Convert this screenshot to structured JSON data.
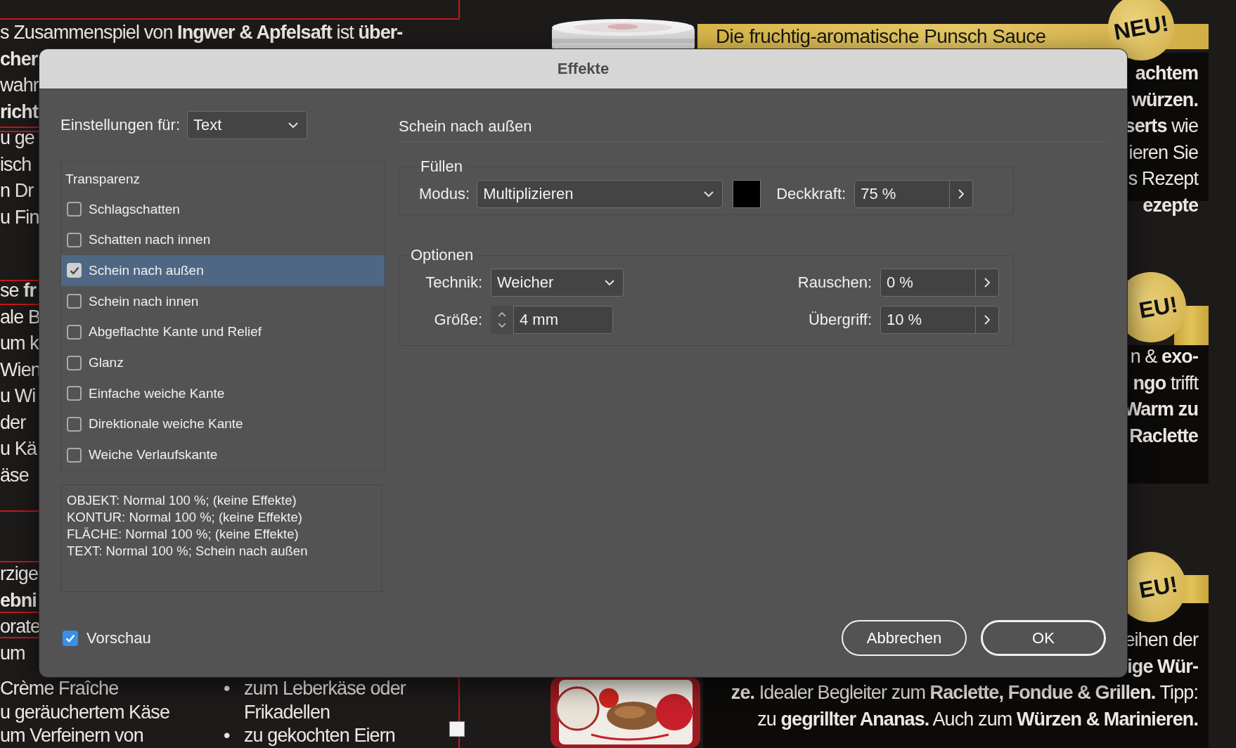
{
  "document": {
    "left_column": [
      {
        "lines": [
          {
            "text": "s Zusammenspiel von **Ingwer & Apfelsaft** ist **über-**",
            "bold": false
          },
          {
            "text": "cher",
            "bold": true
          },
          {
            "text": "wahr",
            "bold": false
          },
          {
            "text": "richt",
            "bold": true
          },
          {
            "text": "u ge",
            "bold": false
          },
          {
            "text": "isch",
            "bold": false
          },
          {
            "text": "n Dr",
            "bold": false
          },
          {
            "text": "u Fin",
            "bold": false
          }
        ]
      },
      {
        "lines": [
          {
            "text": "se **fr**",
            "bold": false
          },
          {
            "text": "ale B",
            "bold": false
          },
          {
            "text": "um k",
            "bold": false
          },
          {
            "text": "Wien",
            "bold": false
          },
          {
            "text": "u Wi",
            "bold": false
          },
          {
            "text": "der",
            "bold": false
          },
          {
            "text": "u Kä",
            "bold": false
          },
          {
            "text": "äse",
            "bold": false
          }
        ]
      },
      {
        "lines": [
          {
            "text": "rzige",
            "bold": false
          },
          {
            "text": "ebni",
            "bold": true
          },
          {
            "text": "orate",
            "bold": false
          },
          {
            "text": "um",
            "bold": false
          }
        ]
      },
      {
        "lines": [
          {
            "text": "Crème Fraîche",
            "bold": false
          },
          {
            "text": "u geräuchertem Käse",
            "bold": false
          },
          {
            "text": "um Verfeinern von",
            "bold": false
          }
        ]
      }
    ],
    "middle_column": [
      {
        "bullet": "•",
        "text": "zum Leberkäse oder"
      },
      {
        "text": "Frikadellen"
      },
      {
        "bullet": "•",
        "text": "zu gekochten Eiern"
      }
    ],
    "banner": "Die fruchtig-aromatische Punsch Sauce",
    "badges": [
      "NEU!",
      "EU!",
      "EU!"
    ],
    "right_column": [
      {
        "lines": [
          {
            "text": "achtem",
            "bold": true
          },
          {
            "text": "würzen.",
            "bold": true
          },
          {
            "text": "**serts** wie",
            "bold": false
          },
          {
            "text": "ieren Sie",
            "bold": false
          },
          {
            "text": "s Rezept",
            "bold": false
          },
          {
            "text": "ezepte",
            "bold": true
          }
        ]
      },
      {
        "lines": [
          {
            "text": "n & **exo-**",
            "bold": false
          },
          {
            "text": "**ngo** trifft",
            "bold": false
          },
          {
            "text": "Warm zu",
            "bold": true
          },
          {
            "text": "Raclette",
            "bold": true
          }
        ]
      },
      {
        "lines": [
          {
            "text": "eihen der",
            "bold": false
          },
          {
            "text": "ige Wür-",
            "bold": true
          },
          {
            "text": "**ze.** Idealer Begleiter zum **Raclette, Fondue & Grillen.** Tipp:",
            "bold": false
          },
          {
            "text": "zu **gegrillter Ananas.** Auch zum **Würzen & Marinieren.**",
            "bold": false
          }
        ]
      }
    ]
  },
  "dialog": {
    "title": "Effekte",
    "settings_for": {
      "label": "Einstellungen für:",
      "value": "Text"
    },
    "effects_header": "Transparenz",
    "effects": [
      {
        "label": "Schlagschatten",
        "checked": false,
        "selected": false
      },
      {
        "label": "Schatten nach innen",
        "checked": false,
        "selected": false
      },
      {
        "label": "Schein nach außen",
        "checked": true,
        "selected": true
      },
      {
        "label": "Schein nach innen",
        "checked": false,
        "selected": false
      },
      {
        "label": "Abgeflachte Kante und Relief",
        "checked": false,
        "selected": false
      },
      {
        "label": "Glanz",
        "checked": false,
        "selected": false
      },
      {
        "label": "Einfache weiche Kante",
        "checked": false,
        "selected": false
      },
      {
        "label": "Direktionale weiche Kante",
        "checked": false,
        "selected": false
      },
      {
        "label": "Weiche Verlaufskante",
        "checked": false,
        "selected": false
      }
    ],
    "summary": [
      "OBJEKT: Normal 100 %; (keine Effekte)",
      "KONTUR: Normal 100 %; (keine Effekte)",
      "FLÄCHE: Normal 100 %; (keine Effekte)",
      "TEXT: Normal 100 %; Schein nach außen"
    ],
    "panel_title": "Schein nach außen",
    "fill_group": {
      "title": "Füllen",
      "mode_label": "Modus:",
      "mode": "Multiplizieren",
      "color": "#000000",
      "opacity_label": "Deckkraft:",
      "opacity": "75 %"
    },
    "options_group": {
      "title": "Optionen",
      "technique_label": "Technik:",
      "technique": "Weicher",
      "size_label": "Größe:",
      "size": "4 mm",
      "noise_label": "Rauschen:",
      "noise": "0 %",
      "spread_label": "Übergriff:",
      "spread": "10 %"
    },
    "preview": {
      "label": "Vorschau",
      "checked": true
    },
    "buttons": [
      "Abbrechen",
      "OK"
    ]
  }
}
